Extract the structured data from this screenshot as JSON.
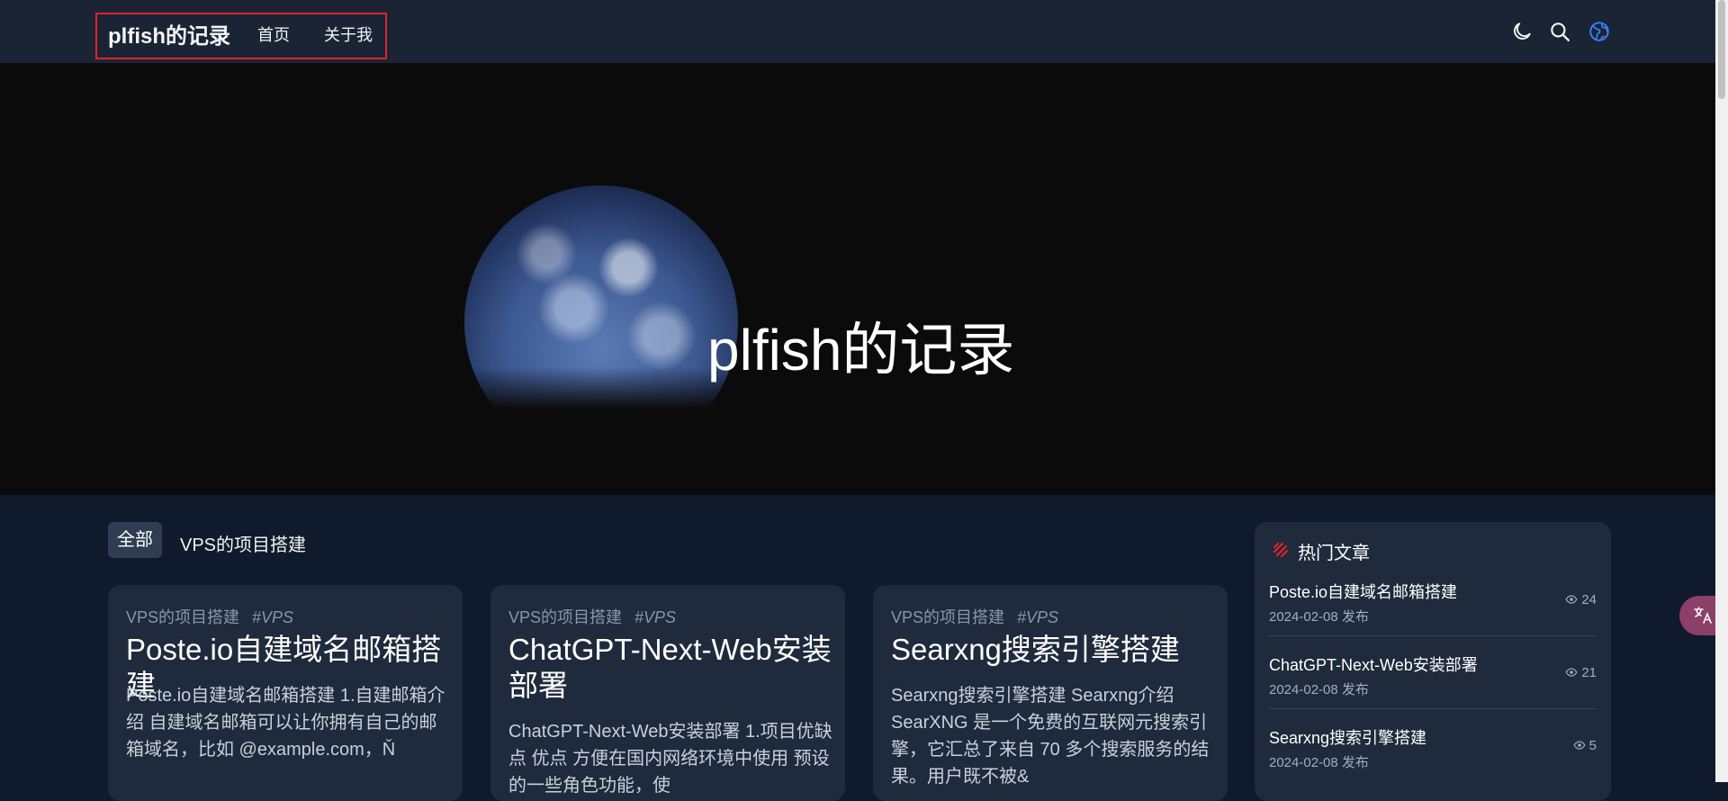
{
  "header": {
    "brand": "plfish的记录",
    "nav": {
      "home": "首页",
      "about": "关于我"
    },
    "icons": [
      "moon-icon",
      "search-icon",
      "globe-icon"
    ],
    "highlight_color": "#e0212b"
  },
  "hero": {
    "title": "plfish的记录"
  },
  "categories": {
    "all": "全部",
    "vps": "VPS的项目搭建"
  },
  "posts": [
    {
      "category": "VPS的项目搭建",
      "tag": "#VPS",
      "title": "Poste.io自建域名邮箱搭建",
      "excerpt": "Poste.io自建域名邮箱搭建 1.自建邮箱介绍 自建域名邮箱可以让你拥有自己的邮箱域名，比如 @example.com，Ň"
    },
    {
      "category": "VPS的项目搭建",
      "tag": "#VPS",
      "title": "ChatGPT-Next-Web安装部署",
      "excerpt": "ChatGPT-Next-Web安装部署 1.项目优缺点 优点 方便在国内网络环境中使用 预设的一些角色功能，使"
    },
    {
      "category": "VPS的项目搭建",
      "tag": "#VPS",
      "title": "Searxng搜索引擎搭建",
      "excerpt": "Searxng搜索引擎搭建 Searxng介绍 SearXNG 是一个免费的互联网元搜索引擎，它汇总了来自 70 多个搜索服务的结果。用户既不被&"
    }
  ],
  "sidebar": {
    "heading": "热门文章",
    "items": [
      {
        "title": "Poste.io自建域名邮箱搭建",
        "date": "2024-02-08 发布",
        "views": "24"
      },
      {
        "title": "ChatGPT-Next-Web安装部署",
        "date": "2024-02-08 发布",
        "views": "21"
      },
      {
        "title": "Searxng搜索引擎搭建",
        "date": "2024-02-08 发布",
        "views": "5"
      }
    ]
  },
  "floating": {
    "icon": "translate-icon",
    "color": "#8c3f68"
  }
}
